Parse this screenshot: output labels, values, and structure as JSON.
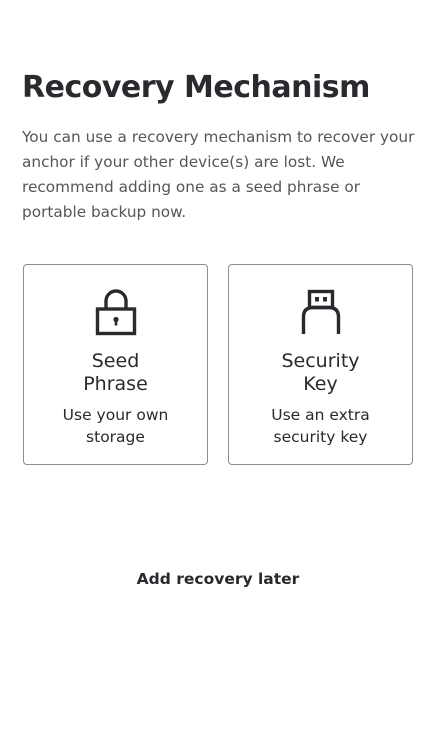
{
  "page": {
    "title": "Recovery Mechanism",
    "description": "You can use a recovery mechanism to recover your anchor if your other device(s) are lost. We recommend adding one as a seed phrase or portable backup now."
  },
  "options": [
    {
      "icon": "lock-icon",
      "title_line1": "Seed",
      "title_line2": "Phrase",
      "subtitle_line1": "Use your own",
      "subtitle_line2": "storage"
    },
    {
      "icon": "usb-key-icon",
      "title_line1": "Security",
      "title_line2": "Key",
      "subtitle_line1": "Use an extra",
      "subtitle_line2": "security key"
    }
  ],
  "actions": {
    "later_label": "Add recovery later"
  },
  "colors": {
    "text_primary": "#292a2e",
    "text_secondary": "#55565a",
    "card_border": "#8d8e92",
    "background": "#ffffff"
  }
}
